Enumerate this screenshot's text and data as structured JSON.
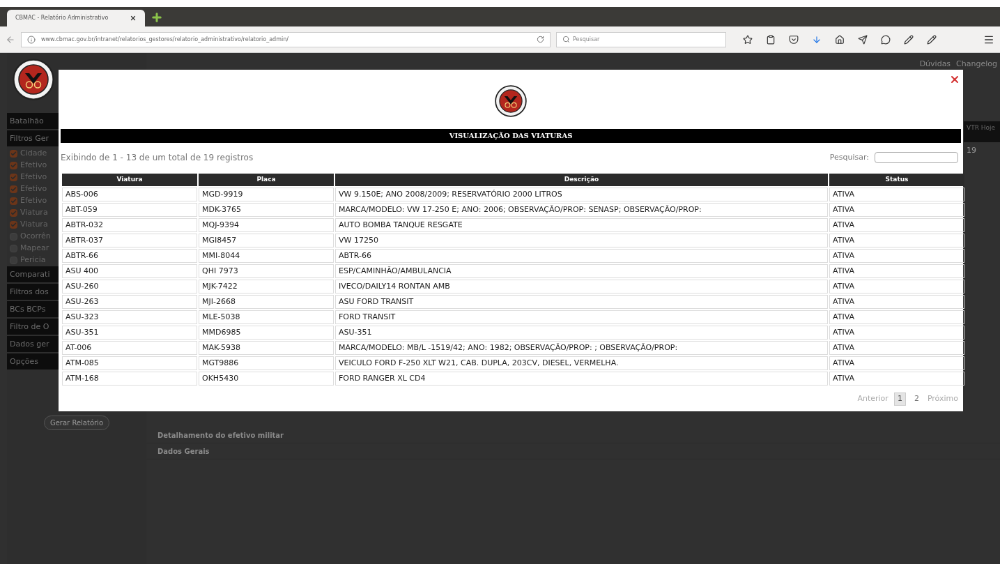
{
  "browser": {
    "tab_title": "CBMAC - Relatório Administrativo",
    "url": "www.cbmac.gov.br/intranet/relatorios_gestores/relatorio_administrativo/relatorio_admin/",
    "search_placeholder": "Pesquisar"
  },
  "page": {
    "header_links": [
      "Dúvidas",
      "Changelog"
    ],
    "sidebar": [
      {
        "kind": "section",
        "label": "Batalhão"
      },
      {
        "kind": "section",
        "label": "Filtros Ger"
      },
      {
        "kind": "check",
        "label": "Cidade",
        "checked": true
      },
      {
        "kind": "check",
        "label": "Efetivo",
        "checked": true
      },
      {
        "kind": "check",
        "label": "Efetivo",
        "checked": true
      },
      {
        "kind": "check",
        "label": "Efetivo",
        "checked": true
      },
      {
        "kind": "check",
        "label": "Efetivo",
        "checked": true
      },
      {
        "kind": "check",
        "label": "Viatura",
        "checked": true
      },
      {
        "kind": "check",
        "label": "Viatura",
        "checked": true
      },
      {
        "kind": "check",
        "label": "Ocorrên",
        "checked": false
      },
      {
        "kind": "check",
        "label": "Mapear",
        "checked": false
      },
      {
        "kind": "check",
        "label": "Pericia",
        "checked": false
      },
      {
        "kind": "section",
        "label": "Comparati"
      },
      {
        "kind": "section",
        "label": "Filtros dos"
      },
      {
        "kind": "section",
        "label": "BCs BCPs"
      },
      {
        "kind": "section",
        "label": "Filtro de O"
      },
      {
        "kind": "section",
        "label": "Dados ger"
      },
      {
        "kind": "section",
        "label": "Opções"
      }
    ],
    "generate_button": "Gerar Relatório",
    "stat": {
      "label": "VTR Hoje",
      "value": "19"
    },
    "sections": [
      "Detalhamento do efetivo militar",
      "Dados Gerais"
    ]
  },
  "modal": {
    "title": "VISUALIZAÇÃO DAS VIATURAS",
    "info": "Exibindo de 1 - 13 de um total de 19 registros",
    "search_label": "Pesquisar:",
    "columns": [
      "Viatura",
      "Placa",
      "Descrição",
      "Status"
    ],
    "rows": [
      [
        "ABS-006",
        "MGD-9919",
        "VW 9.150E; ANO 2008/2009; RESERVATÓRIO 2000 LITROS",
        "ATIVA"
      ],
      [
        "ABT-059",
        "MDK-3765",
        "MARCA/MODELO: VW 17-250 E; ANO: 2006; OBSERVAÇÃO/PROP: SENASP; OBSERVAÇÃO/PROP:",
        "ATIVA"
      ],
      [
        "ABTR-032",
        "MQJ-9394",
        "AUTO BOMBA TANQUE RESGATE",
        "ATIVA"
      ],
      [
        "ABTR-037",
        "MGI8457",
        "VW 17250",
        "ATIVA"
      ],
      [
        "ABTR-66",
        "MMI-8044",
        "ABTR-66",
        "ATIVA"
      ],
      [
        "ASU 400",
        "QHI 7973",
        "ESP/CAMINHÃO/AMBULANCIA",
        "ATIVA"
      ],
      [
        "ASU-260",
        "MJK-7422",
        "IVECO/DAILY14 RONTAN AMB",
        "ATIVA"
      ],
      [
        "ASU-263",
        "MJI-2668",
        "ASU FORD TRANSIT",
        "ATIVA"
      ],
      [
        "ASU-323",
        "MLE-5038",
        "FORD TRANSIT",
        "ATIVA"
      ],
      [
        "ASU-351",
        "MMD6985",
        "ASU-351",
        "ATIVA"
      ],
      [
        "AT-006",
        "MAK-5938",
        "MARCA/MODELO: MB/L -1519/42; ANO: 1982; OBSERVAÇÃO/PROP: ; OBSERVAÇÃO/PROP:",
        "ATIVA"
      ],
      [
        "ATM-085",
        "MGT9886",
        "VEICULO FORD F-250 XLT W21, CAB. DUPLA, 203CV, DIESEL, VERMELHA.",
        "ATIVA"
      ],
      [
        "ATM-168",
        "OKH5430",
        "FORD RANGER XL CD4",
        "ATIVA"
      ]
    ],
    "pagination": {
      "previous": "Anterior",
      "pages": [
        {
          "label": "1",
          "selected": true
        },
        {
          "label": "2",
          "selected": false
        }
      ],
      "next": "Próximo"
    }
  }
}
